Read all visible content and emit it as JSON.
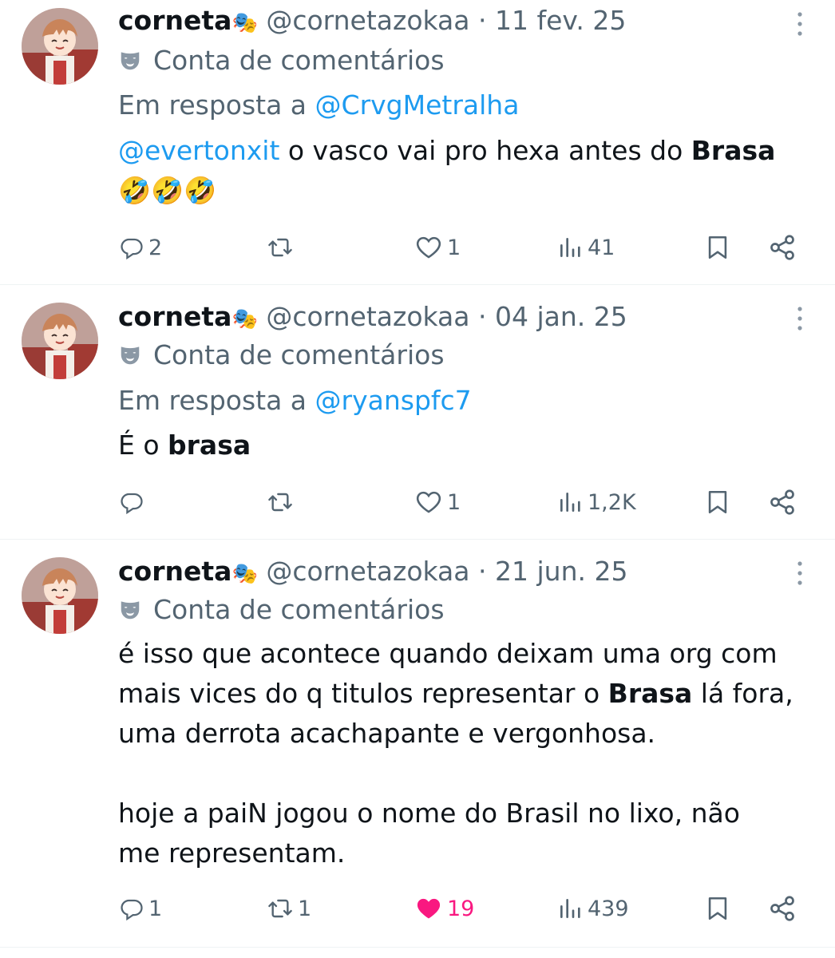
{
  "tweets": [
    {
      "name": "corneta",
      "name_emoji": "🎭",
      "handle": "@cornetazokaa",
      "separator": "·",
      "date": "11 fev. 25",
      "badge": "Conta de comentários",
      "reply_prefix": "Em resposta a",
      "reply_to": "@CrvgMetralha",
      "text_mention": "@evertonxit",
      "text_before": " o vasco vai pro hexa antes do ",
      "text_bold": "Brasa",
      "text_after": "",
      "text_line2": "🤣🤣🤣",
      "replies": "2",
      "retweets": "",
      "likes": "1",
      "views": "41",
      "liked": false
    },
    {
      "name": "corneta",
      "name_emoji": "🎭",
      "handle": "@cornetazokaa",
      "separator": "·",
      "date": "04 jan. 25",
      "badge": "Conta de comentários",
      "reply_prefix": "Em resposta a",
      "reply_to": "@ryanspfc7",
      "text_before": "É o ",
      "text_bold": "brasa",
      "replies": "",
      "retweets": "",
      "likes": "1",
      "views": "1,2K",
      "liked": false
    },
    {
      "name": "corneta",
      "name_emoji": "🎭",
      "handle": "@cornetazokaa",
      "separator": "·",
      "date": "21 jun. 25",
      "badge": "Conta de comentários",
      "line1": "é isso que acontece quando deixam uma org com",
      "line2_before": "mais vices do q titulos representar o ",
      "line2_bold": "Brasa",
      "line2_after": " lá fora,",
      "line3": "uma derrota acachapante e vergonhosa.",
      "line4": "hoje a paiN jogou o nome do Brasil no lixo, não",
      "line5": "me representam.",
      "replies": "1",
      "retweets": "1",
      "likes": "19",
      "views": "439",
      "liked": true
    }
  ],
  "colors": {
    "text": "#0f1419",
    "secondary": "#536471",
    "link": "#1d9bf0",
    "like_active": "#f91880",
    "divider": "#eff3f4"
  },
  "icons": {
    "reply": "reply-icon",
    "retweet": "retweet-icon",
    "like": "heart-icon",
    "views": "views-icon",
    "bookmark": "bookmark-icon",
    "share": "share-icon",
    "more": "more-vertical-icon",
    "badge": "theater-mask-icon"
  }
}
